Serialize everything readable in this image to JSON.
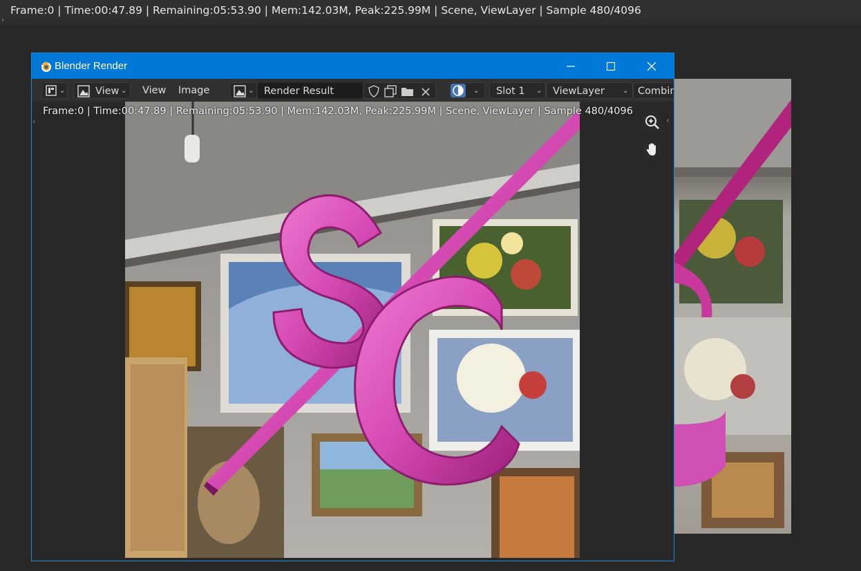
{
  "main": {
    "status_line": "Frame:0 | Time:00:47.89 | Remaining:05:53.90 | Mem:142.03M, Peak:225.99M | Scene, ViewLayer | Sample 480/4096"
  },
  "window": {
    "title": "Blender Render",
    "controls": [
      "minimize-icon",
      "maximize-icon",
      "close-icon"
    ]
  },
  "header": {
    "editor_type_icon": "image-editor-icon",
    "mode_label": "View",
    "menu_view": "View",
    "menu_image": "Image",
    "image_name": "Render Result",
    "slot": "Slot 1",
    "view_layer": "ViewLayer",
    "pass": "Combin"
  },
  "overlay": {
    "status_line": "Frame:0 | Time:00:47.89 | Remaining:05:53.90 | Mem:142.03M, Peak:225.99M | Scene, ViewLayer | Sample 480/4096"
  },
  "tools": [
    "zoom-icon",
    "hand-pan-icon"
  ],
  "colors": {
    "titlebar": "#0078d7",
    "logo_pink": "#d44fb8",
    "ui_dark": "#303030"
  }
}
